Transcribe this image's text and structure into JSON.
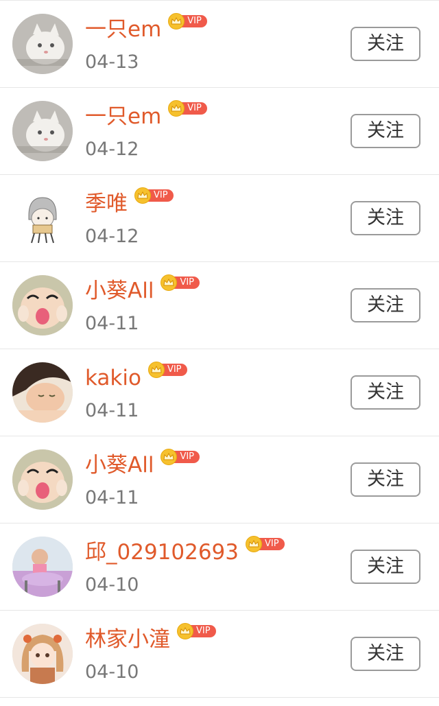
{
  "vip_label": "VIP",
  "follow_label": "关注",
  "colors": {
    "name": "#e05a2b",
    "vip_bg": "#f05a4a",
    "crown": "#f6c12e"
  },
  "items": [
    {
      "name": "一只em",
      "date": "04-13",
      "avatar": "cat-avatar"
    },
    {
      "name": "一只em",
      "date": "04-12",
      "avatar": "cat-avatar"
    },
    {
      "name": "季唯",
      "date": "04-12",
      "avatar": "cartoon-girl-avatar"
    },
    {
      "name": "小葵All",
      "date": "04-11",
      "avatar": "crying-cartoon-avatar"
    },
    {
      "name": "kakio",
      "date": "04-11",
      "avatar": "sleeping-child-avatar"
    },
    {
      "name": "小葵All",
      "date": "04-11",
      "avatar": "crying-cartoon-avatar"
    },
    {
      "name": "邱_029102693",
      "date": "04-10",
      "avatar": "baby-photo-avatar"
    },
    {
      "name": "林家小潼",
      "date": "04-10",
      "avatar": "anime-girl-avatar"
    }
  ]
}
